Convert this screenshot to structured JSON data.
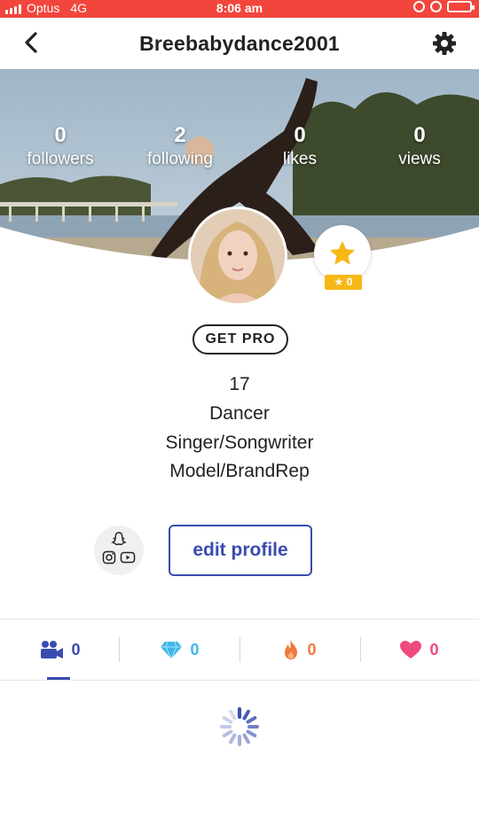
{
  "status_bar": {
    "carrier": "Optus",
    "network": "4G",
    "time": "8:06 am"
  },
  "nav": {
    "title": "Breebabydance2001"
  },
  "stats": [
    {
      "value": "0",
      "label": "followers"
    },
    {
      "value": "2",
      "label": "following"
    },
    {
      "value": "0",
      "label": "likes"
    },
    {
      "value": "0",
      "label": "views"
    }
  ],
  "badge": {
    "star_count": "★ 0"
  },
  "get_pro_label": "GET PRO",
  "bio": [
    "17",
    "Dancer",
    "Singer/Songwriter",
    "Model/BrandRep"
  ],
  "edit_profile_label": "edit profile",
  "tabs": [
    {
      "icon": "video-camera-icon",
      "count": "0",
      "color": "#3a4bb0"
    },
    {
      "icon": "diamond-icon",
      "count": "0",
      "color": "#3fb7e8"
    },
    {
      "icon": "fire-icon",
      "count": "0",
      "color": "#f07a3a"
    },
    {
      "icon": "heart-icon",
      "count": "0",
      "color": "#ee4a7d"
    }
  ],
  "colors": {
    "status_bar": "#f2453c",
    "accent": "#3a4bb0",
    "star": "#f6b817"
  }
}
